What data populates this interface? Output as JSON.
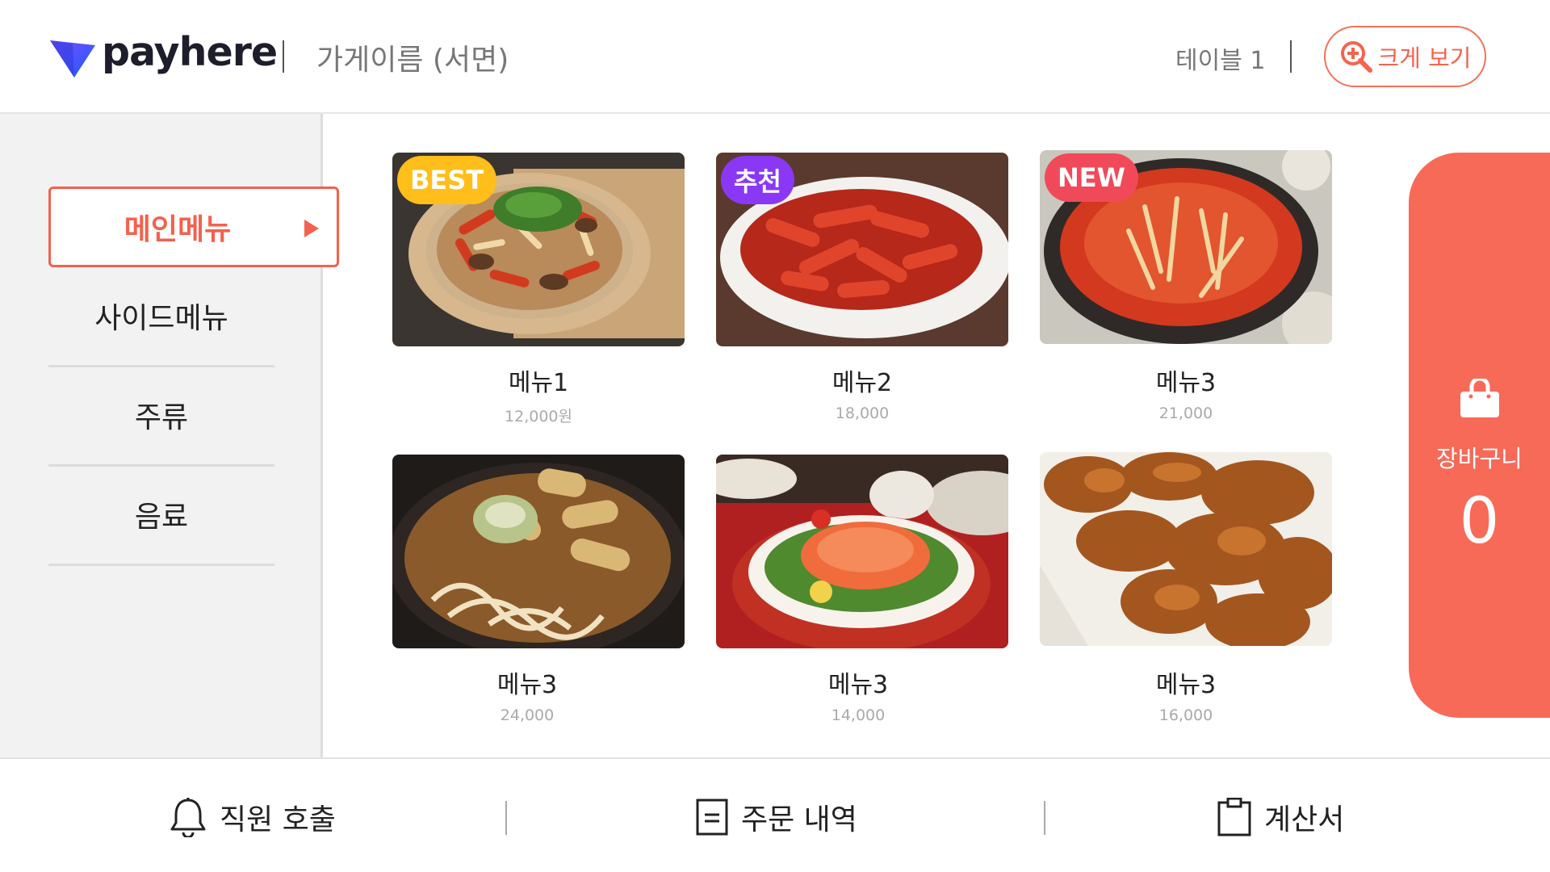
{
  "header": {
    "brand": "payhere",
    "store_name": "가게이름 (서면)",
    "table_label": "테이블 1",
    "zoom_label": "크게 보기"
  },
  "categories": [
    {
      "label": "메인메뉴",
      "active": true
    },
    {
      "label": "사이드메뉴"
    },
    {
      "label": "주류"
    },
    {
      "label": "음료"
    }
  ],
  "menu_items": [
    {
      "name": "메뉴1",
      "price": "12,000원",
      "badge": "BEST",
      "badge_color": "#ffbe1a",
      "dish": "pizza"
    },
    {
      "name": "메뉴2",
      "price": "18,000",
      "badge": "추천",
      "badge_color": "#8a38f5",
      "dish": "tteokbokki"
    },
    {
      "name": "메뉴3",
      "price": "21,000",
      "badge": "NEW",
      "badge_color": "#f04a5a",
      "dish": "hotpot"
    },
    {
      "name": "메뉴3",
      "price": "24,000",
      "dish": "udon"
    },
    {
      "name": "메뉴3",
      "price": "14,000",
      "dish": "salmon-salad"
    },
    {
      "name": "메뉴3",
      "price": "16,000",
      "dish": "fried-chicken"
    }
  ],
  "cart": {
    "label": "장바구니",
    "count": "0"
  },
  "footer": {
    "call_staff": "직원 호출",
    "order_history": "주문 내역",
    "bill": "계산서"
  },
  "colors": {
    "accent": "#f76a58",
    "accent_text": "#f4614d"
  }
}
